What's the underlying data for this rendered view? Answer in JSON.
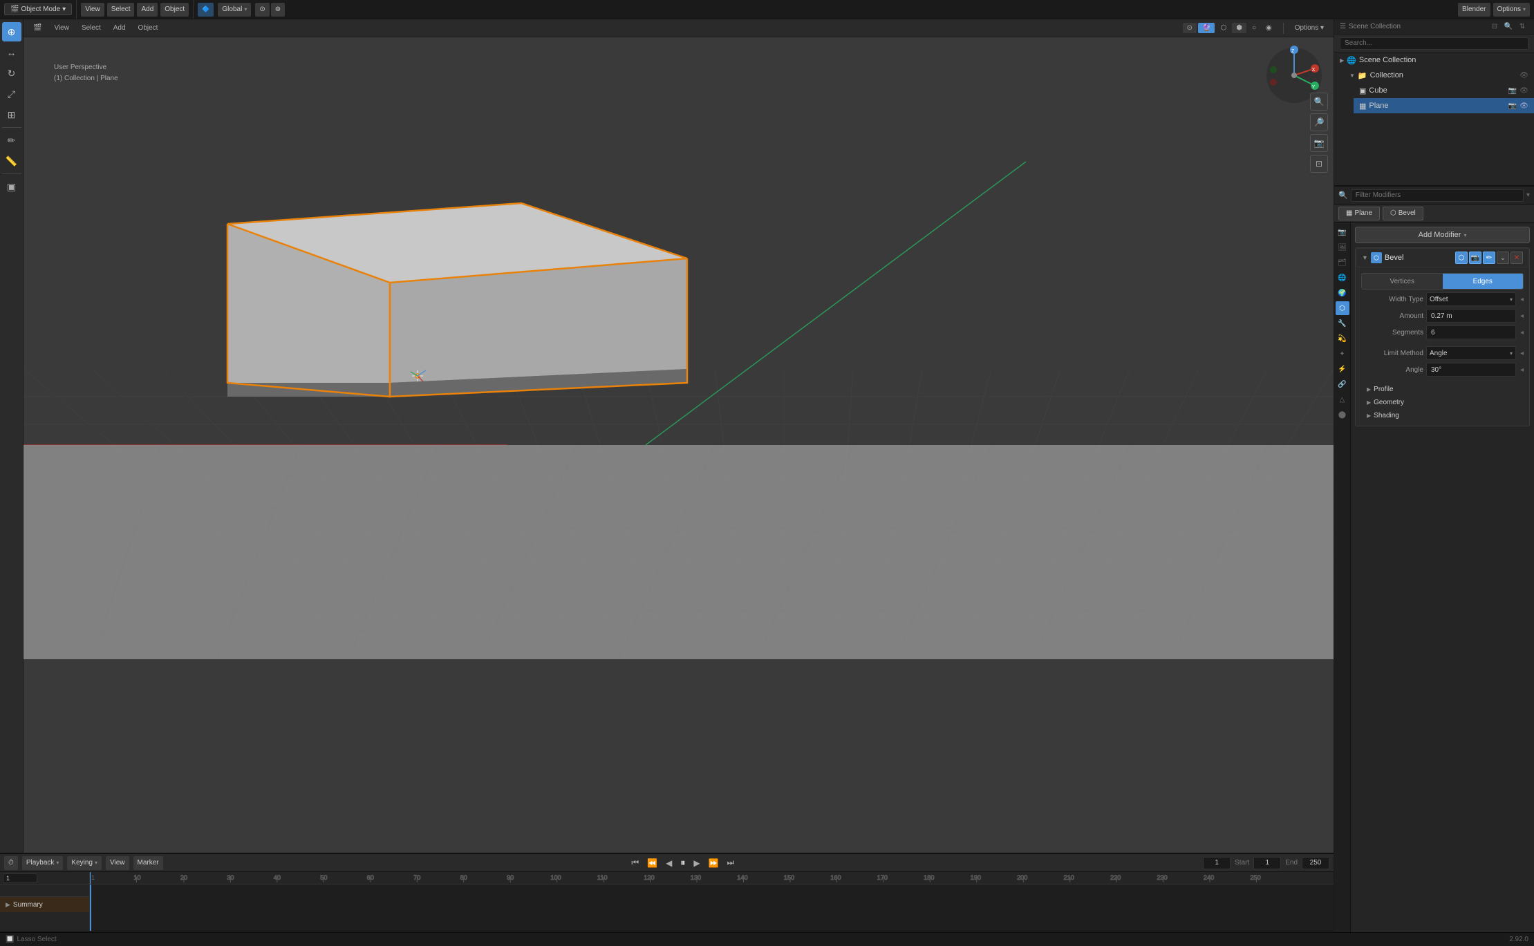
{
  "app": {
    "title": "Blender"
  },
  "header": {
    "editor_type": "Object Mode",
    "transform_space": "Global",
    "menu_items": [
      "Select",
      "Add",
      "Object"
    ],
    "options_label": "Options",
    "view_label": "View",
    "select_label": "Select"
  },
  "viewport": {
    "view_label": "User Perspective",
    "collection_label": "(1) Collection | Plane",
    "menu": {
      "view": "View",
      "select": "Select",
      "add": "Add",
      "object": "Object"
    }
  },
  "tools": {
    "items": [
      {
        "name": "cursor",
        "icon": "⊕"
      },
      {
        "name": "move",
        "icon": "↔"
      },
      {
        "name": "rotate",
        "icon": "↻"
      },
      {
        "name": "scale",
        "icon": "⤢"
      },
      {
        "name": "transform",
        "icon": "⊞"
      },
      {
        "name": "annotate",
        "icon": "✏"
      },
      {
        "name": "measure",
        "icon": "📐"
      },
      {
        "name": "add-cube",
        "icon": "▣"
      }
    ]
  },
  "outliner": {
    "title": "Scene Collection",
    "scene_collection_label": "Scene Collection",
    "items": [
      {
        "label": "Collection",
        "icon": "📁",
        "indent": 1,
        "active": false
      },
      {
        "label": "Cube",
        "icon": "▣",
        "indent": 2,
        "active": false
      },
      {
        "label": "Plane",
        "icon": "▦",
        "indent": 2,
        "active": true
      }
    ]
  },
  "properties": {
    "modifier_tab": "Plane",
    "bevel_tab": "Bevel",
    "add_modifier_label": "Add Modifier",
    "bevel_modifier": {
      "name": "Bevel",
      "vertices_label": "Vertices",
      "edges_label": "Edges",
      "width_type_label": "Width Type",
      "width_type_value": "Offset",
      "amount_label": "Amount",
      "amount_value": "0.27 m",
      "segments_label": "Segments",
      "segments_value": "6",
      "limit_method_label": "Limit Method",
      "limit_method_value": "Angle",
      "angle_label": "Angle",
      "angle_value": "30°"
    },
    "sections": [
      {
        "label": "Profile",
        "collapsed": true
      },
      {
        "label": "Geometry",
        "collapsed": true
      },
      {
        "label": "Shading",
        "collapsed": true
      }
    ]
  },
  "timeline": {
    "playback_label": "Playback",
    "keying_label": "Keying",
    "view_label": "View",
    "marker_label": "Marker",
    "start_label": "Start",
    "end_label": "End",
    "start_value": "1",
    "end_value": "250",
    "current_frame": "1",
    "frame_markers": [
      "1",
      "10",
      "20",
      "30",
      "40",
      "50",
      "60",
      "70",
      "80",
      "90",
      "100",
      "110",
      "120",
      "130",
      "140",
      "150",
      "160",
      "170",
      "180",
      "190",
      "200",
      "210",
      "220",
      "230",
      "240",
      "250"
    ],
    "summary_label": "Summary"
  },
  "status_bar": {
    "select_label": "Lasso Select",
    "version": "2.92.0"
  },
  "scene": {
    "box_color": "#b0b0b0",
    "box_outline_color": "#e8820a",
    "floor_color": "#a0a0a0",
    "grid_color": "#444",
    "axis_x_color": "#c0392b",
    "axis_y_color": "#27ae60"
  }
}
